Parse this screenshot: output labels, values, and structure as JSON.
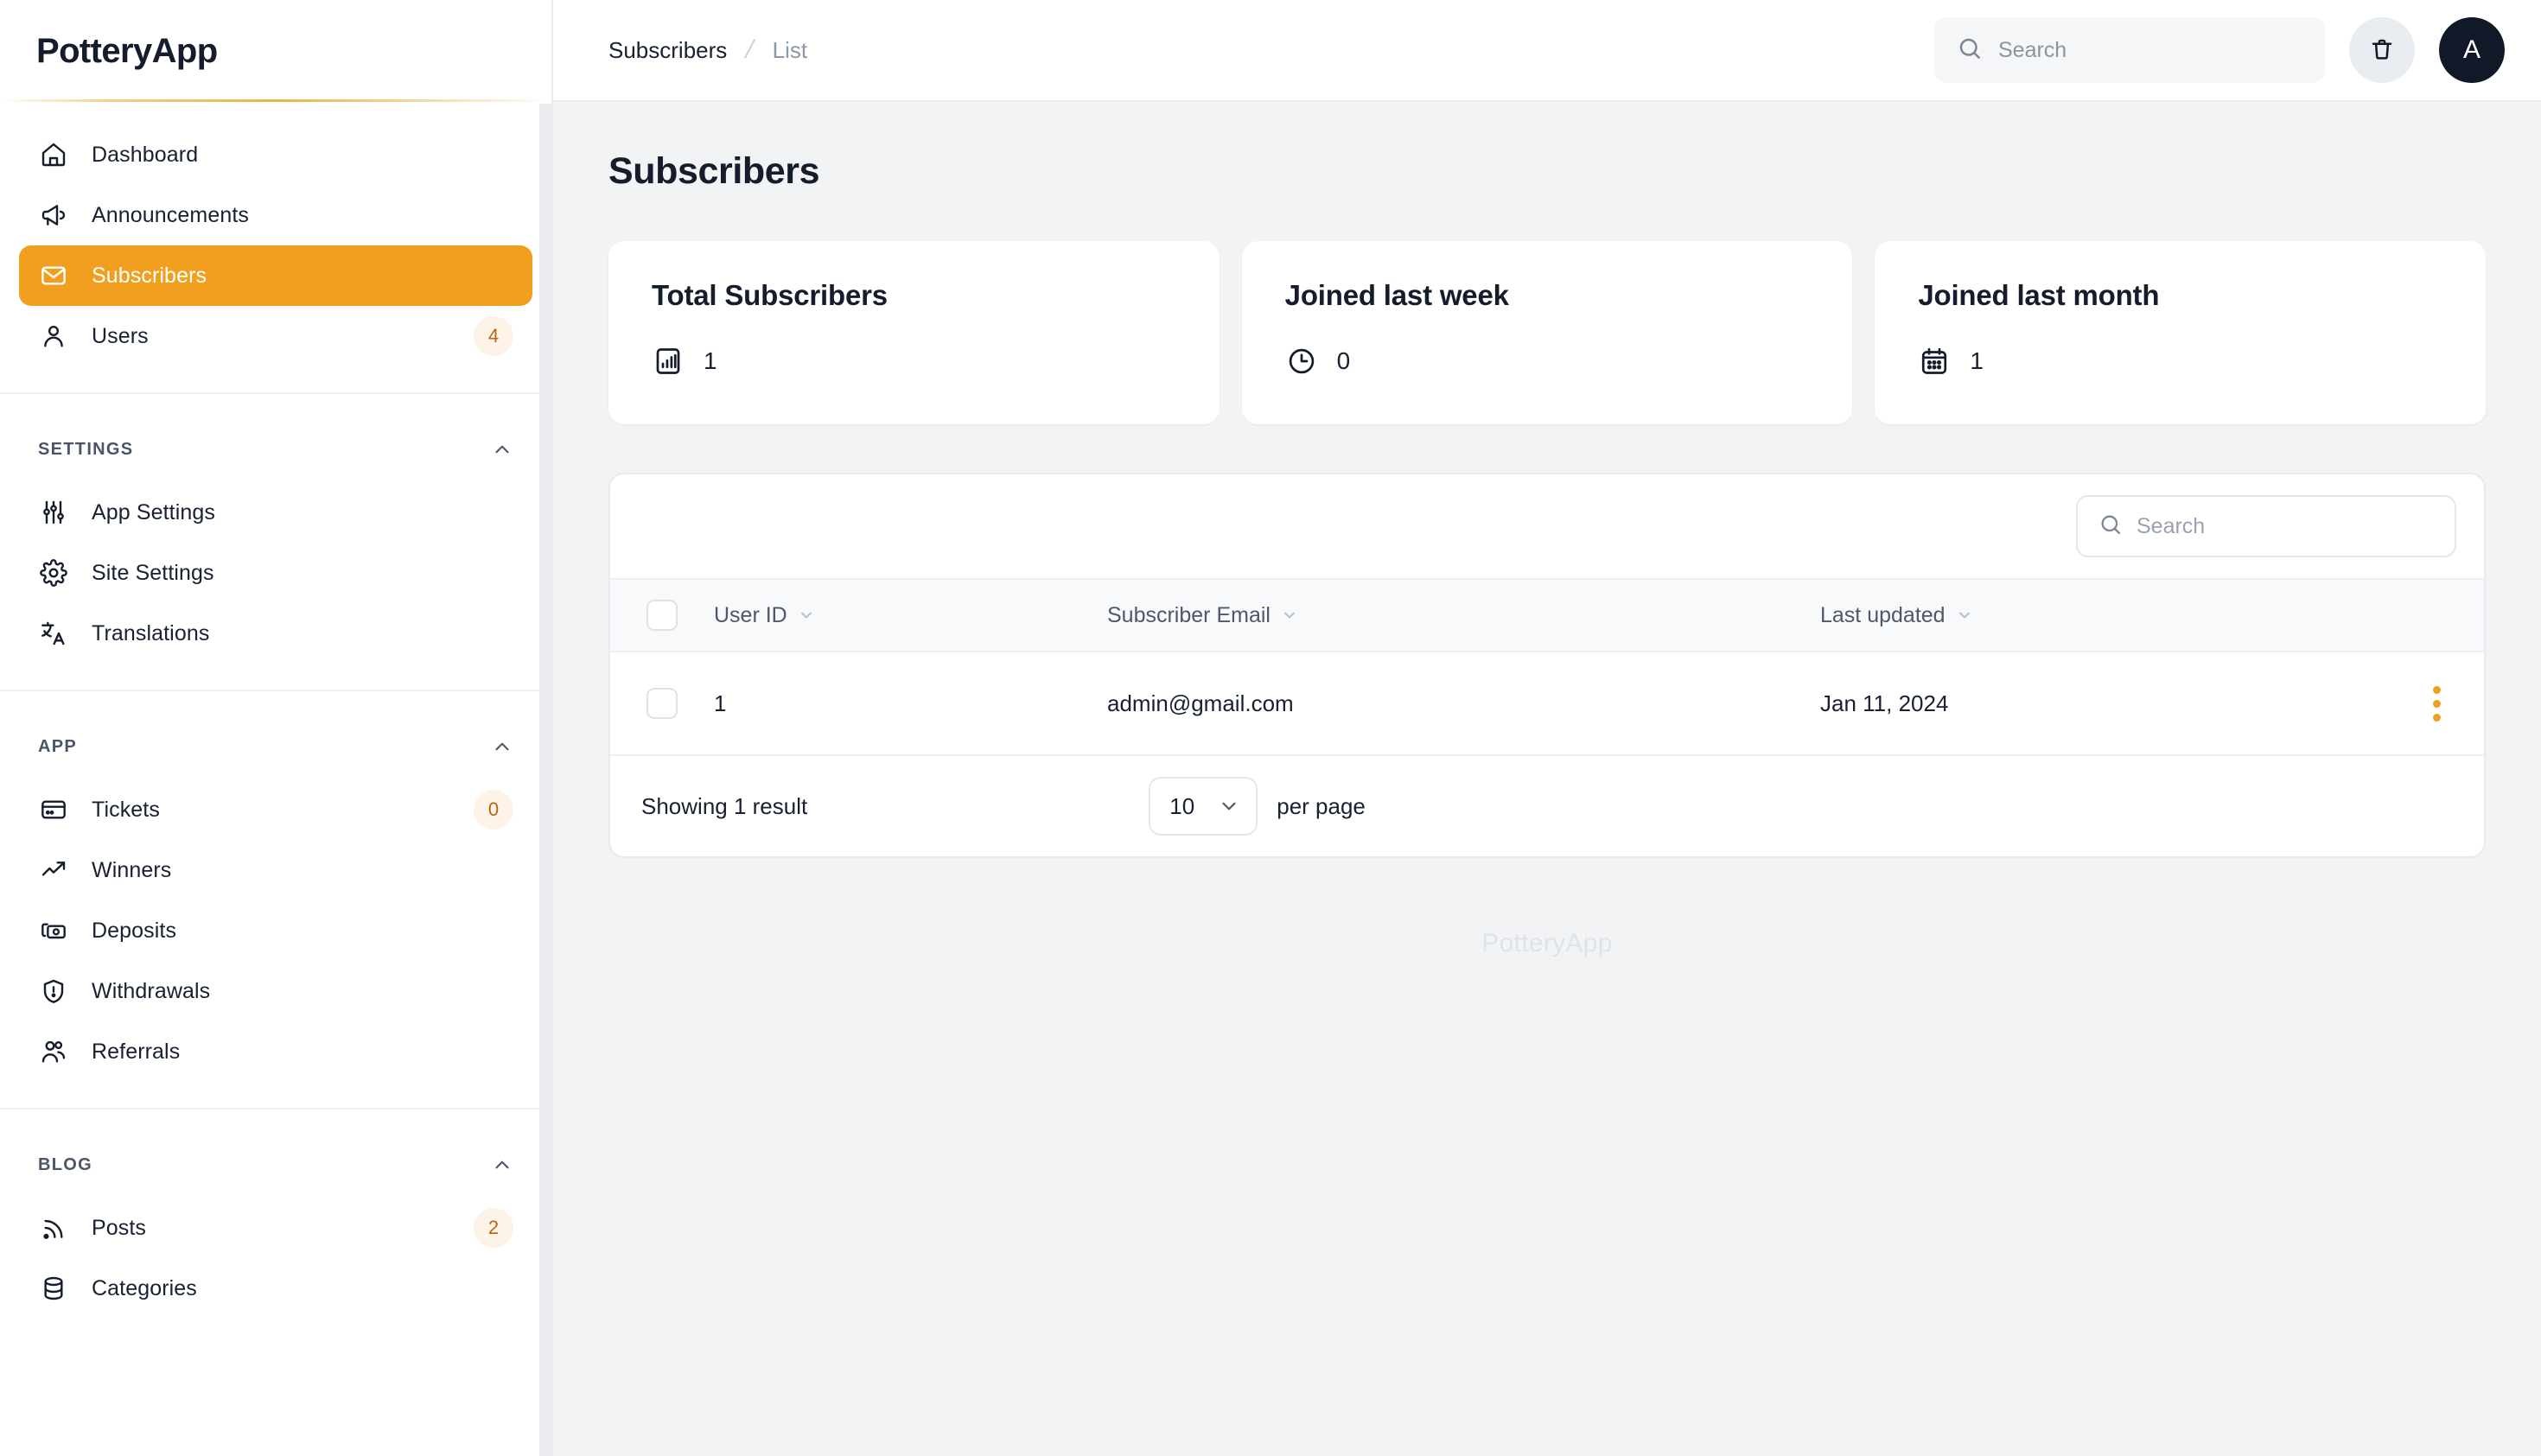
{
  "brand": {
    "name": "PotteryApp",
    "accent": "#f0a01e",
    "dark": "#151c2c"
  },
  "sidebar": {
    "main_items": [
      {
        "label": "Dashboard",
        "icon": "home-icon",
        "badge": null,
        "active": false
      },
      {
        "label": "Announcements",
        "icon": "megaphone-icon",
        "badge": null,
        "active": false
      },
      {
        "label": "Subscribers",
        "icon": "envelope-icon",
        "badge": null,
        "active": true
      },
      {
        "label": "Users",
        "icon": "user-icon",
        "badge": "4",
        "active": false
      }
    ],
    "sections": [
      {
        "title": "SETTINGS",
        "items": [
          {
            "label": "App Settings",
            "icon": "sliders-icon",
            "badge": null
          },
          {
            "label": "Site Settings",
            "icon": "gear-icon",
            "badge": null
          },
          {
            "label": "Translations",
            "icon": "translate-icon",
            "badge": null
          }
        ]
      },
      {
        "title": "APP",
        "items": [
          {
            "label": "Tickets",
            "icon": "ticket-icon",
            "badge": "0"
          },
          {
            "label": "Winners",
            "icon": "trending-up-icon",
            "badge": null
          },
          {
            "label": "Deposits",
            "icon": "money-icon",
            "badge": null
          },
          {
            "label": "Withdrawals",
            "icon": "shield-icon",
            "badge": null
          },
          {
            "label": "Referrals",
            "icon": "users-icon",
            "badge": null
          }
        ]
      },
      {
        "title": "BLOG",
        "items": [
          {
            "label": "Posts",
            "icon": "rss-icon",
            "badge": "2"
          },
          {
            "label": "Categories",
            "icon": "database-icon",
            "badge": null
          }
        ]
      }
    ]
  },
  "topbar": {
    "breadcrumb_main": "Subscribers",
    "breadcrumb_sub": "List",
    "search_placeholder": "Search",
    "search_value": "",
    "trash_icon": "trash-icon",
    "avatar_initial": "A"
  },
  "page": {
    "title": "Subscribers",
    "watermark": "PotteryApp"
  },
  "stats": [
    {
      "label": "Total Subscribers",
      "value": "1",
      "icon": "bar-chart-icon"
    },
    {
      "label": "Joined last week",
      "value": "0",
      "icon": "clock-icon"
    },
    {
      "label": "Joined last month",
      "value": "1",
      "icon": "calendar-icon"
    }
  ],
  "table": {
    "search_placeholder": "Search",
    "search_value": "",
    "columns": [
      {
        "key": "id",
        "label": "User ID",
        "sortable": true
      },
      {
        "key": "email",
        "label": "Subscriber Email",
        "sortable": true
      },
      {
        "key": "upd",
        "label": "Last updated",
        "sortable": true
      }
    ],
    "rows": [
      {
        "id": "1",
        "email": "admin@gmail.com",
        "upd": "Jan 11, 2024"
      }
    ],
    "footer": {
      "showing": "Showing 1 result",
      "per_page_value": "10",
      "per_page_label": "per page"
    }
  }
}
